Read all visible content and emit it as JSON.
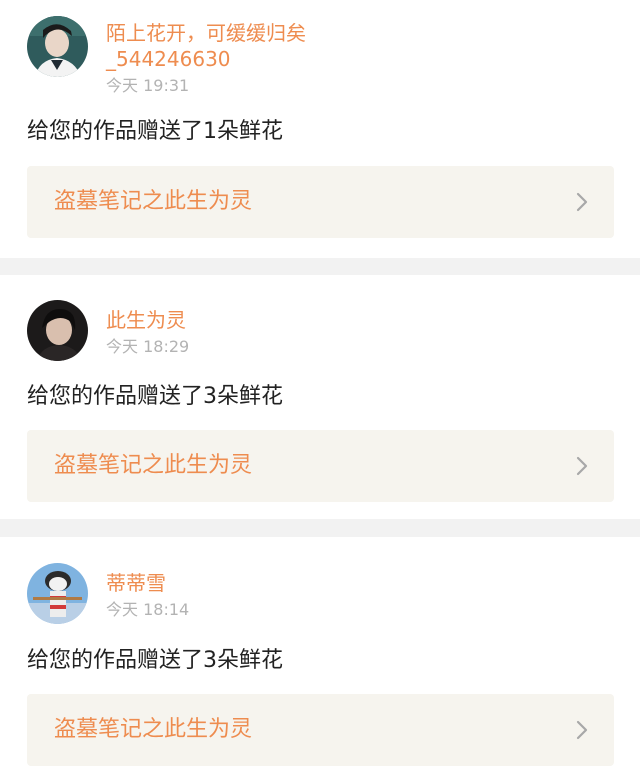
{
  "notifications": [
    {
      "username": "陌上花开，可缓缓归矣\n_544246630",
      "time": "今天 19:31",
      "message": "给您的作品赠送了1朵鲜花",
      "work_title": "盗墓笔记之此生为灵",
      "avatar_icon": "user-avatar-icon"
    },
    {
      "username": "此生为灵",
      "time": "今天 18:29",
      "message": "给您的作品赠送了3朵鲜花",
      "work_title": "盗墓笔记之此生为灵",
      "avatar_icon": "user-avatar-icon"
    },
    {
      "username": "蒂蒂雪",
      "time": "今天 18:14",
      "message": "给您的作品赠送了3朵鲜花",
      "work_title": "盗墓笔记之此生为灵",
      "avatar_icon": "user-avatar-icon"
    }
  ],
  "colors": {
    "accent": "#ee8c4f",
    "timestamp": "#b3b3b3",
    "text": "#222222",
    "link_bg": "#f6f4ee",
    "separator": "#f2f2f2"
  },
  "icons": {
    "chevron": "chevron-right-icon"
  }
}
